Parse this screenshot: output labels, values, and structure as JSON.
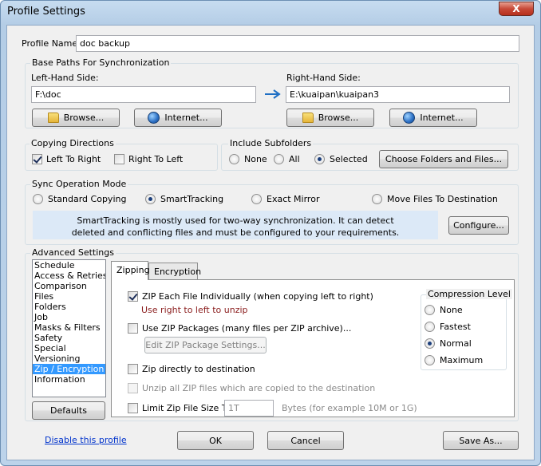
{
  "window": {
    "title": "Profile Settings",
    "close_label": "X"
  },
  "profile": {
    "label": "Profile Name:",
    "value": "doc backup"
  },
  "base_paths": {
    "legend": "Base Paths For Synchronization",
    "left": {
      "label": "Left-Hand Side:",
      "value": "F:\\doc",
      "browse": "Browse...",
      "internet": "Internet..."
    },
    "right": {
      "label": "Right-Hand Side:",
      "value": "E:\\kuaipan\\kuaipan3",
      "browse": "Browse...",
      "internet": "Internet..."
    }
  },
  "copying": {
    "legend": "Copying Directions",
    "left_to_right": "Left To Right",
    "right_to_left": "Right To Left",
    "left_to_right_checked": true,
    "right_to_left_checked": false
  },
  "subfolders": {
    "legend": "Include Subfolders",
    "none": "None",
    "all": "All",
    "selected": "Selected",
    "choose": "Choose Folders and Files...",
    "current": "selected"
  },
  "sync_mode": {
    "legend": "Sync Operation Mode",
    "standard": "Standard Copying",
    "smart": "SmartTracking",
    "mirror": "Exact Mirror",
    "move": "Move Files To Destination",
    "current": "smart",
    "info_line1": "SmartTracking is mostly used for two-way synchronization. It can detect",
    "info_line2": "deleted and conflicting files and must be configured to your requirements.",
    "configure": "Configure..."
  },
  "advanced": {
    "legend": "Advanced Settings",
    "items": [
      "Schedule",
      "Access & Retries",
      "Comparison",
      "Files",
      "Folders",
      "Job",
      "Masks & Filters",
      "Safety",
      "Special",
      "Versioning",
      "Zip / Encryption",
      "Information"
    ],
    "selected_index": 10,
    "defaults": "Defaults",
    "tabs": {
      "zipping": "Zipping",
      "encryption": "Encryption"
    },
    "zip_each": "ZIP Each File Individually (when copying left to right)",
    "zip_each_checked": true,
    "zip_hint": "Use right to left to unzip",
    "zip_packages": "Use ZIP Packages (many files per ZIP archive)...",
    "edit_packages": "Edit ZIP Package Settings...",
    "zip_direct": "Zip directly to destination",
    "unzip_all": "Unzip all ZIP files which are copied to the destination",
    "limit": "Limit Zip File Size To",
    "limit_value": "1T",
    "limit_hint": "Bytes (for example 10M or 1G)",
    "compression": {
      "legend": "Compression Level",
      "none": "None",
      "fastest": "Fastest",
      "normal": "Normal",
      "maximum": "Maximum",
      "current": "normal"
    }
  },
  "footer": {
    "disable": "Disable this profile",
    "ok": "OK",
    "cancel": "Cancel",
    "save_as": "Save As..."
  }
}
